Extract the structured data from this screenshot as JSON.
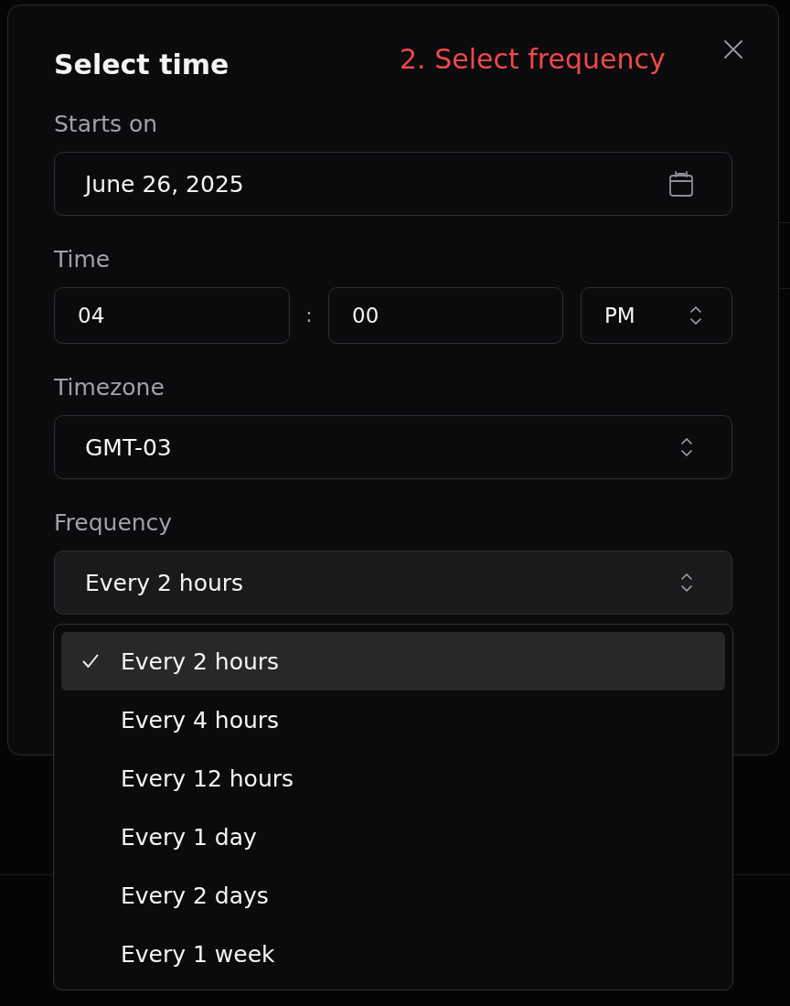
{
  "annotation": "2. Select frequency",
  "dialog": {
    "title": "Select time",
    "starts_on": {
      "label": "Starts on",
      "value": "June 26, 2025"
    },
    "time": {
      "label": "Time",
      "hour": "04",
      "separator": ":",
      "minute": "00",
      "period": "PM"
    },
    "timezone": {
      "label": "Timezone",
      "value": "GMT-03"
    },
    "frequency": {
      "label": "Frequency",
      "value": "Every 2 hours",
      "expanded": true
    }
  },
  "frequency_menu": {
    "options": [
      {
        "label": "Every 2 hours",
        "selected": true
      },
      {
        "label": "Every 4 hours",
        "selected": false
      },
      {
        "label": "Every 12 hours",
        "selected": false
      },
      {
        "label": "Every 1 day",
        "selected": false
      },
      {
        "label": "Every 2 days",
        "selected": false
      },
      {
        "label": "Every 1 week",
        "selected": false
      }
    ]
  }
}
